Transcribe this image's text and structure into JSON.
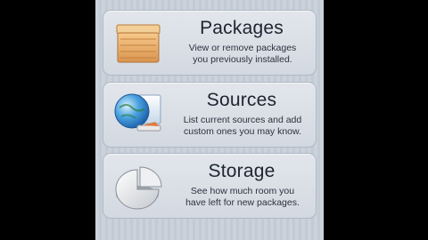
{
  "items": [
    {
      "title": "Packages",
      "description_line1": "View or remove packages",
      "description_line2": "you previously installed.",
      "icon": "box-icon"
    },
    {
      "title": "Sources",
      "description_line1": "List current sources and add",
      "description_line2": "custom ones you may know.",
      "icon": "globe-icon"
    },
    {
      "title": "Storage",
      "description_line1": "See how much room you",
      "description_line2": "have left for new packages.",
      "icon": "pie-chart-icon"
    }
  ]
}
